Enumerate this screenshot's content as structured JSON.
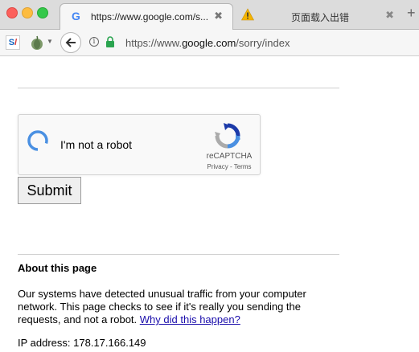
{
  "browser": {
    "tabs": [
      {
        "title": "https://www.google.com/s...",
        "favicon": "google-g-icon",
        "close": "✖"
      },
      {
        "title": "页面载入出错",
        "favicon": "warning-icon",
        "close": "✖"
      }
    ],
    "new_tab": "+",
    "url": {
      "scheme": "https://www.",
      "host": "google.com",
      "path": "/sorry/index"
    },
    "info_glyph": "i"
  },
  "recaptcha": {
    "label": "I'm not a robot",
    "brand": "reCAPTCHA",
    "privacy": "Privacy",
    "separator": " - ",
    "terms": "Terms"
  },
  "form": {
    "submit_label": "Submit"
  },
  "about": {
    "heading": "About this page",
    "text": "Our systems have detected unusual traffic from your computer network. This page checks to see if it's really you sending the requests, and not a robot. ",
    "link": "Why did this happen?",
    "ip_label": "IP address: ",
    "ip_value": "178.17.166.149"
  },
  "colors": {
    "link": "#1a0dab",
    "google_blue": "#4285f4",
    "secure_green": "#2aa44f",
    "warning_yellow": "#f4b400"
  }
}
